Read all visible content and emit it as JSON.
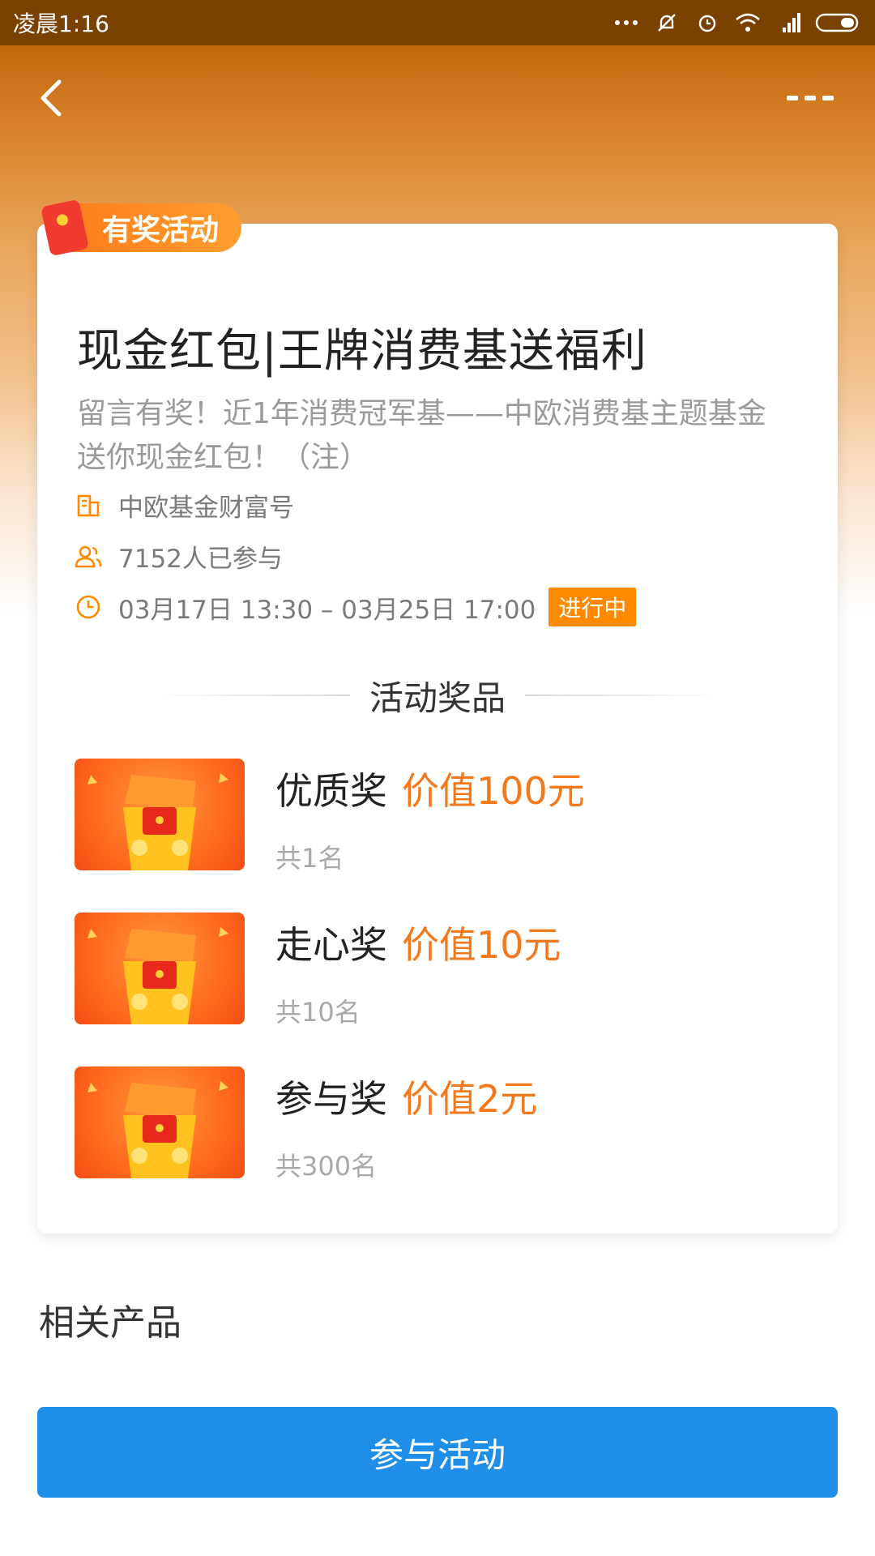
{
  "status_bar": {
    "time": "凌晨1:16",
    "icons": [
      "more-dots-icon",
      "bell-muted-icon",
      "alarm-icon",
      "wifi-icon",
      "signal-hd-icon",
      "battery-icon"
    ]
  },
  "nav": {
    "back_icon": "chevron-left-icon",
    "more_icon": "more-dots-icon"
  },
  "tag": {
    "label": "有奖活动"
  },
  "activity": {
    "title": "现金红包|王牌消费基送福利",
    "subtitle": "留言有奖！近1年消费冠军基——中欧消费基主题基金送你现金红包！（注）",
    "publisher": "中欧基金财富号",
    "participants": "7152人已参与",
    "time_range": "03月17日 13:30 – 03月25日 17:00",
    "status": "进行中"
  },
  "prizes_section": {
    "title": "活动奖品",
    "items": [
      {
        "name": "优质奖",
        "value": "价值100元",
        "count": "共1名"
      },
      {
        "name": "走心奖",
        "value": "价值10元",
        "count": "共10名"
      },
      {
        "name": "参与奖",
        "value": "价值2元",
        "count": "共300名"
      }
    ]
  },
  "related": {
    "title": "相关产品"
  },
  "cta": {
    "label": "参与活动"
  },
  "colors": {
    "accent_orange": "#ff8a00",
    "price_orange": "#f27a1c",
    "cta_blue": "#1e8ee8"
  }
}
